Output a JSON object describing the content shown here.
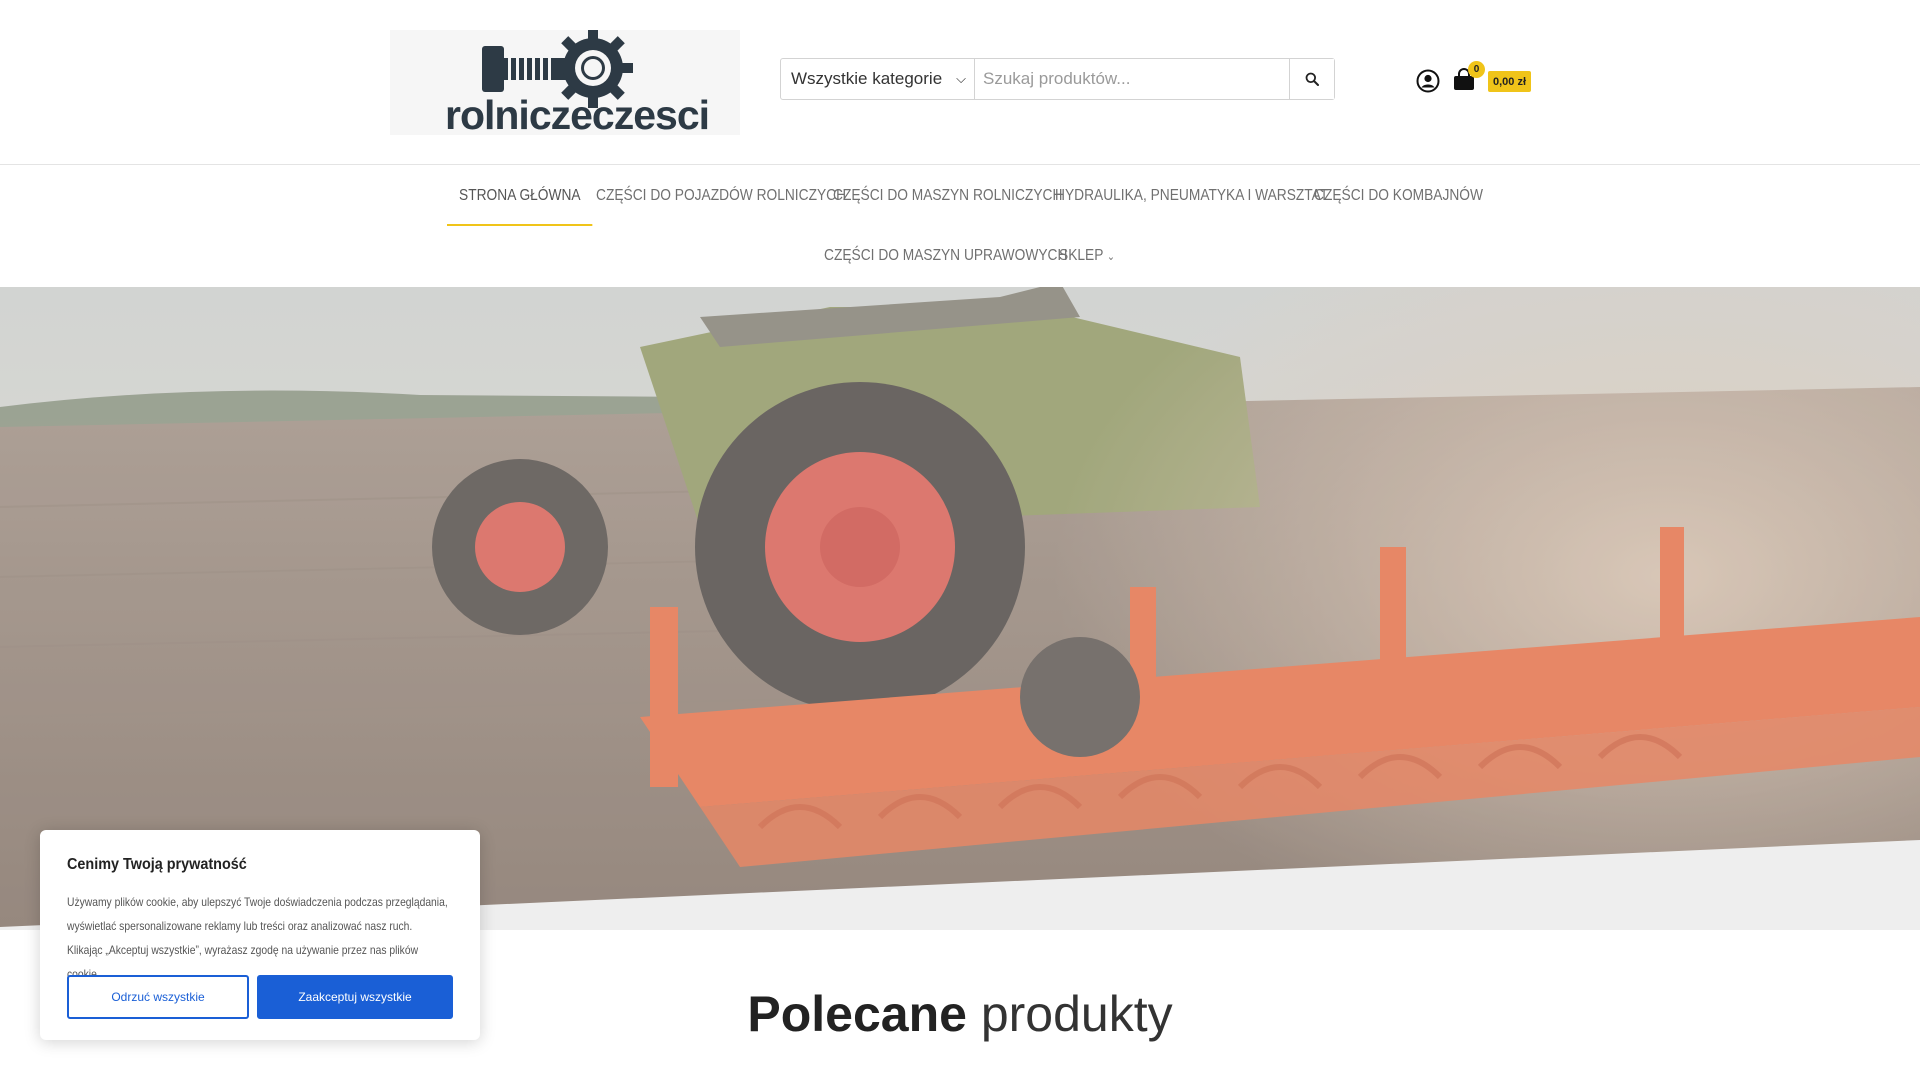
{
  "brand": {
    "logo_text": "rolniczeczesci"
  },
  "search": {
    "category_selected": "Wszystkie kategorie",
    "placeholder": "Szukaj produktów..."
  },
  "cart": {
    "count": "0",
    "total": "0,00 zł"
  },
  "nav": {
    "items": [
      {
        "label": "STRONA GŁÓWNA"
      },
      {
        "label": "CZĘŚCI DO POJAZDÓW ROLNICZYCH"
      },
      {
        "label": "CZĘŚCI DO MASZYN ROLNICZYCH"
      },
      {
        "label": "HYDRAULIKA, PNEUMATYKA I WARSZTAT"
      },
      {
        "label": "CZĘŚCI DO KOMBAJNÓW"
      },
      {
        "label": "CZĘŚCI DO MASZYN UPRAWOWYCH"
      },
      {
        "label": "SKLEP"
      }
    ]
  },
  "featured": {
    "title_bold": "Polecane",
    "title_light": "produkty"
  },
  "cookie": {
    "title": "Cenimy Twoją prywatność",
    "text": "Używamy plików cookie, aby ulepszyć Twoje doświadczenia podczas przeglądania, wyświetlać spersonalizowane reklamy lub treści oraz analizować nasz ruch. Klikając „Akceptuj wszystkie”, wyrażasz zgodę na używanie przez nas plików cookie.",
    "reject_label": "Odrzuć wszystkie",
    "accept_label": "Zaakceptuj wszystkie"
  },
  "colors": {
    "accent": "#f0c419",
    "button_blue": "#1a5fd6"
  }
}
